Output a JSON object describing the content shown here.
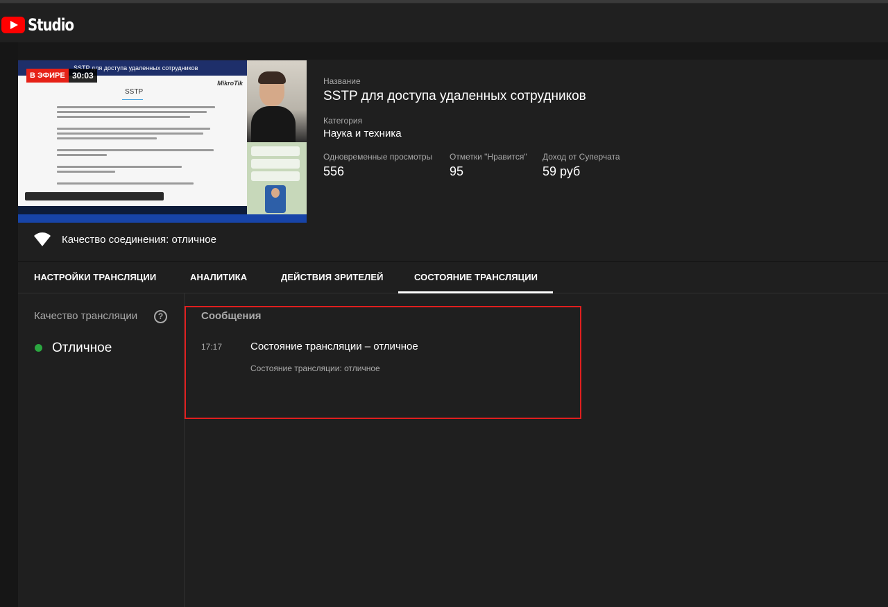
{
  "app": {
    "logo_text": "Studio"
  },
  "preview": {
    "live_badge": "В ЭФИРЕ",
    "duration": "30:03",
    "slide_topbar_text": "SSTP для доступа удаленных сотрудников",
    "slide_logo": "MikroTik",
    "slide_heading": "SSTP"
  },
  "stream": {
    "title_label": "Название",
    "title": "SSTP для доступа удаленных сотрудников",
    "category_label": "Категория",
    "category": "Наука и техника",
    "stats": [
      {
        "label": "Одновременные просмотры",
        "value": "556"
      },
      {
        "label": "Отметки \"Нравится\"",
        "value": "95"
      },
      {
        "label": "Доход от Суперчата",
        "value": "59 руб"
      }
    ]
  },
  "connection": {
    "icon": "wifi-icon",
    "text": "Качество соединения: отличное"
  },
  "tabs": [
    {
      "label": "НАСТРОЙКИ ТРАНСЛЯЦИИ",
      "active": false
    },
    {
      "label": "АНАЛИТИКА",
      "active": false
    },
    {
      "label": "ДЕЙСТВИЯ ЗРИТЕЛЕЙ",
      "active": false
    },
    {
      "label": "СОСТОЯНИЕ ТРАНСЛЯЦИИ",
      "active": true
    }
  ],
  "quality": {
    "label": "Качество трансляции",
    "help_icon": "help-icon",
    "status": "Отличное",
    "status_color": "#2ba640"
  },
  "messages": {
    "heading": "Сообщения",
    "items": [
      {
        "time": "17:17",
        "title": "Состояние трансляции – отличное",
        "body": "Состояние трансляции: отличное"
      }
    ]
  },
  "colors": {
    "accent_red": "#ff0000",
    "highlight_border": "#e01e1e",
    "background": "#1f1f1f"
  }
}
